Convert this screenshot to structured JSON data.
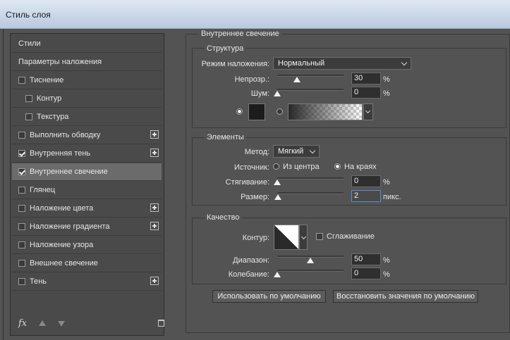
{
  "window": {
    "title": "Стиль слоя"
  },
  "styles_list": [
    {
      "label": "Стили",
      "checkbox": false,
      "checked": false,
      "indent": false,
      "plus": false,
      "selected": false
    },
    {
      "label": "Параметры наложения",
      "checkbox": false,
      "checked": false,
      "indent": false,
      "plus": false,
      "selected": false
    },
    {
      "label": "Тиснение",
      "checkbox": true,
      "checked": false,
      "indent": false,
      "plus": false,
      "selected": false
    },
    {
      "label": "Контур",
      "checkbox": true,
      "checked": false,
      "indent": true,
      "plus": false,
      "selected": false
    },
    {
      "label": "Текстура",
      "checkbox": true,
      "checked": false,
      "indent": true,
      "plus": false,
      "selected": false
    },
    {
      "label": "Выполнить обводку",
      "checkbox": true,
      "checked": false,
      "indent": false,
      "plus": true,
      "selected": false
    },
    {
      "label": "Внутренняя тень",
      "checkbox": true,
      "checked": true,
      "indent": false,
      "plus": true,
      "selected": false
    },
    {
      "label": "Внутреннее свечение",
      "checkbox": true,
      "checked": true,
      "indent": false,
      "plus": false,
      "selected": true
    },
    {
      "label": "Глянец",
      "checkbox": true,
      "checked": false,
      "indent": false,
      "plus": false,
      "selected": false
    },
    {
      "label": "Наложение цвета",
      "checkbox": true,
      "checked": false,
      "indent": false,
      "plus": true,
      "selected": false
    },
    {
      "label": "Наложение градиента",
      "checkbox": true,
      "checked": false,
      "indent": false,
      "plus": true,
      "selected": false
    },
    {
      "label": "Наложение узора",
      "checkbox": true,
      "checked": false,
      "indent": false,
      "plus": false,
      "selected": false
    },
    {
      "label": "Внешнее свечение",
      "checkbox": true,
      "checked": false,
      "indent": false,
      "plus": false,
      "selected": false
    },
    {
      "label": "Тень",
      "checkbox": true,
      "checked": false,
      "indent": false,
      "plus": true,
      "selected": false
    }
  ],
  "footer": {
    "fx_label": "fx"
  },
  "panel": {
    "title": "Внутреннее свечение",
    "structure": {
      "title": "Структура",
      "blend_mode_label": "Режим наложения:",
      "blend_mode_value": "Нормальный",
      "opacity_label": "Непрозр.:",
      "opacity_value": "30",
      "opacity_percent": 30,
      "opacity_unit": "%",
      "noise_label": "Шум:",
      "noise_value": "0",
      "noise_percent": 0,
      "noise_unit": "%",
      "color_mode": "solid"
    },
    "elements": {
      "title": "Элементы",
      "method_label": "Метод:",
      "method_value": "Мягкий",
      "source_label": "Источник:",
      "source_center": "Из центра",
      "source_edge": "На краях",
      "source_selected": "edge",
      "choke_label": "Стягивание:",
      "choke_value": "0",
      "choke_percent": 0,
      "choke_unit": "%",
      "size_label": "Размер:",
      "size_value": "2",
      "size_percent": 0.8,
      "size_unit": "пикс."
    },
    "quality": {
      "title": "Качество",
      "contour_label": "Контур:",
      "antialias_label": "Сглаживание",
      "antialias_checked": false,
      "range_label": "Диапазон:",
      "range_value": "50",
      "range_percent": 50,
      "range_unit": "%",
      "jitter_label": "Колебание:",
      "jitter_value": "0",
      "jitter_percent": 0,
      "jitter_unit": "%"
    },
    "buttons": {
      "make_default": "Использовать по умолчанию",
      "reset_default": "Восстановить значения по умолчанию"
    }
  }
}
